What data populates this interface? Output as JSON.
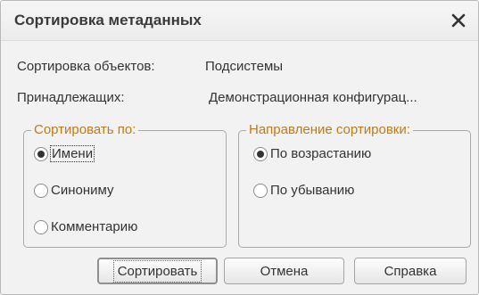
{
  "dialog": {
    "title": "Сортировка метаданных",
    "close_icon": "close-icon"
  },
  "info": {
    "objects_label": "Сортировка объектов:",
    "objects_value": "Подсистемы",
    "belongs_label": "Принадлежащих:",
    "belongs_value": "Демонстрационная конфигурац..."
  },
  "sort_by": {
    "legend": "Сортировать по:",
    "options": [
      {
        "label": "Имени",
        "checked": true
      },
      {
        "label": "Синониму",
        "checked": false
      },
      {
        "label": "Комментарию",
        "checked": false
      }
    ]
  },
  "direction": {
    "legend": "Направление сортировки:",
    "options": [
      {
        "label": "По возрастанию",
        "checked": true
      },
      {
        "label": "По убыванию",
        "checked": false
      }
    ]
  },
  "buttons": {
    "sort": "Сортировать",
    "cancel": "Отмена",
    "help": "Справка"
  }
}
